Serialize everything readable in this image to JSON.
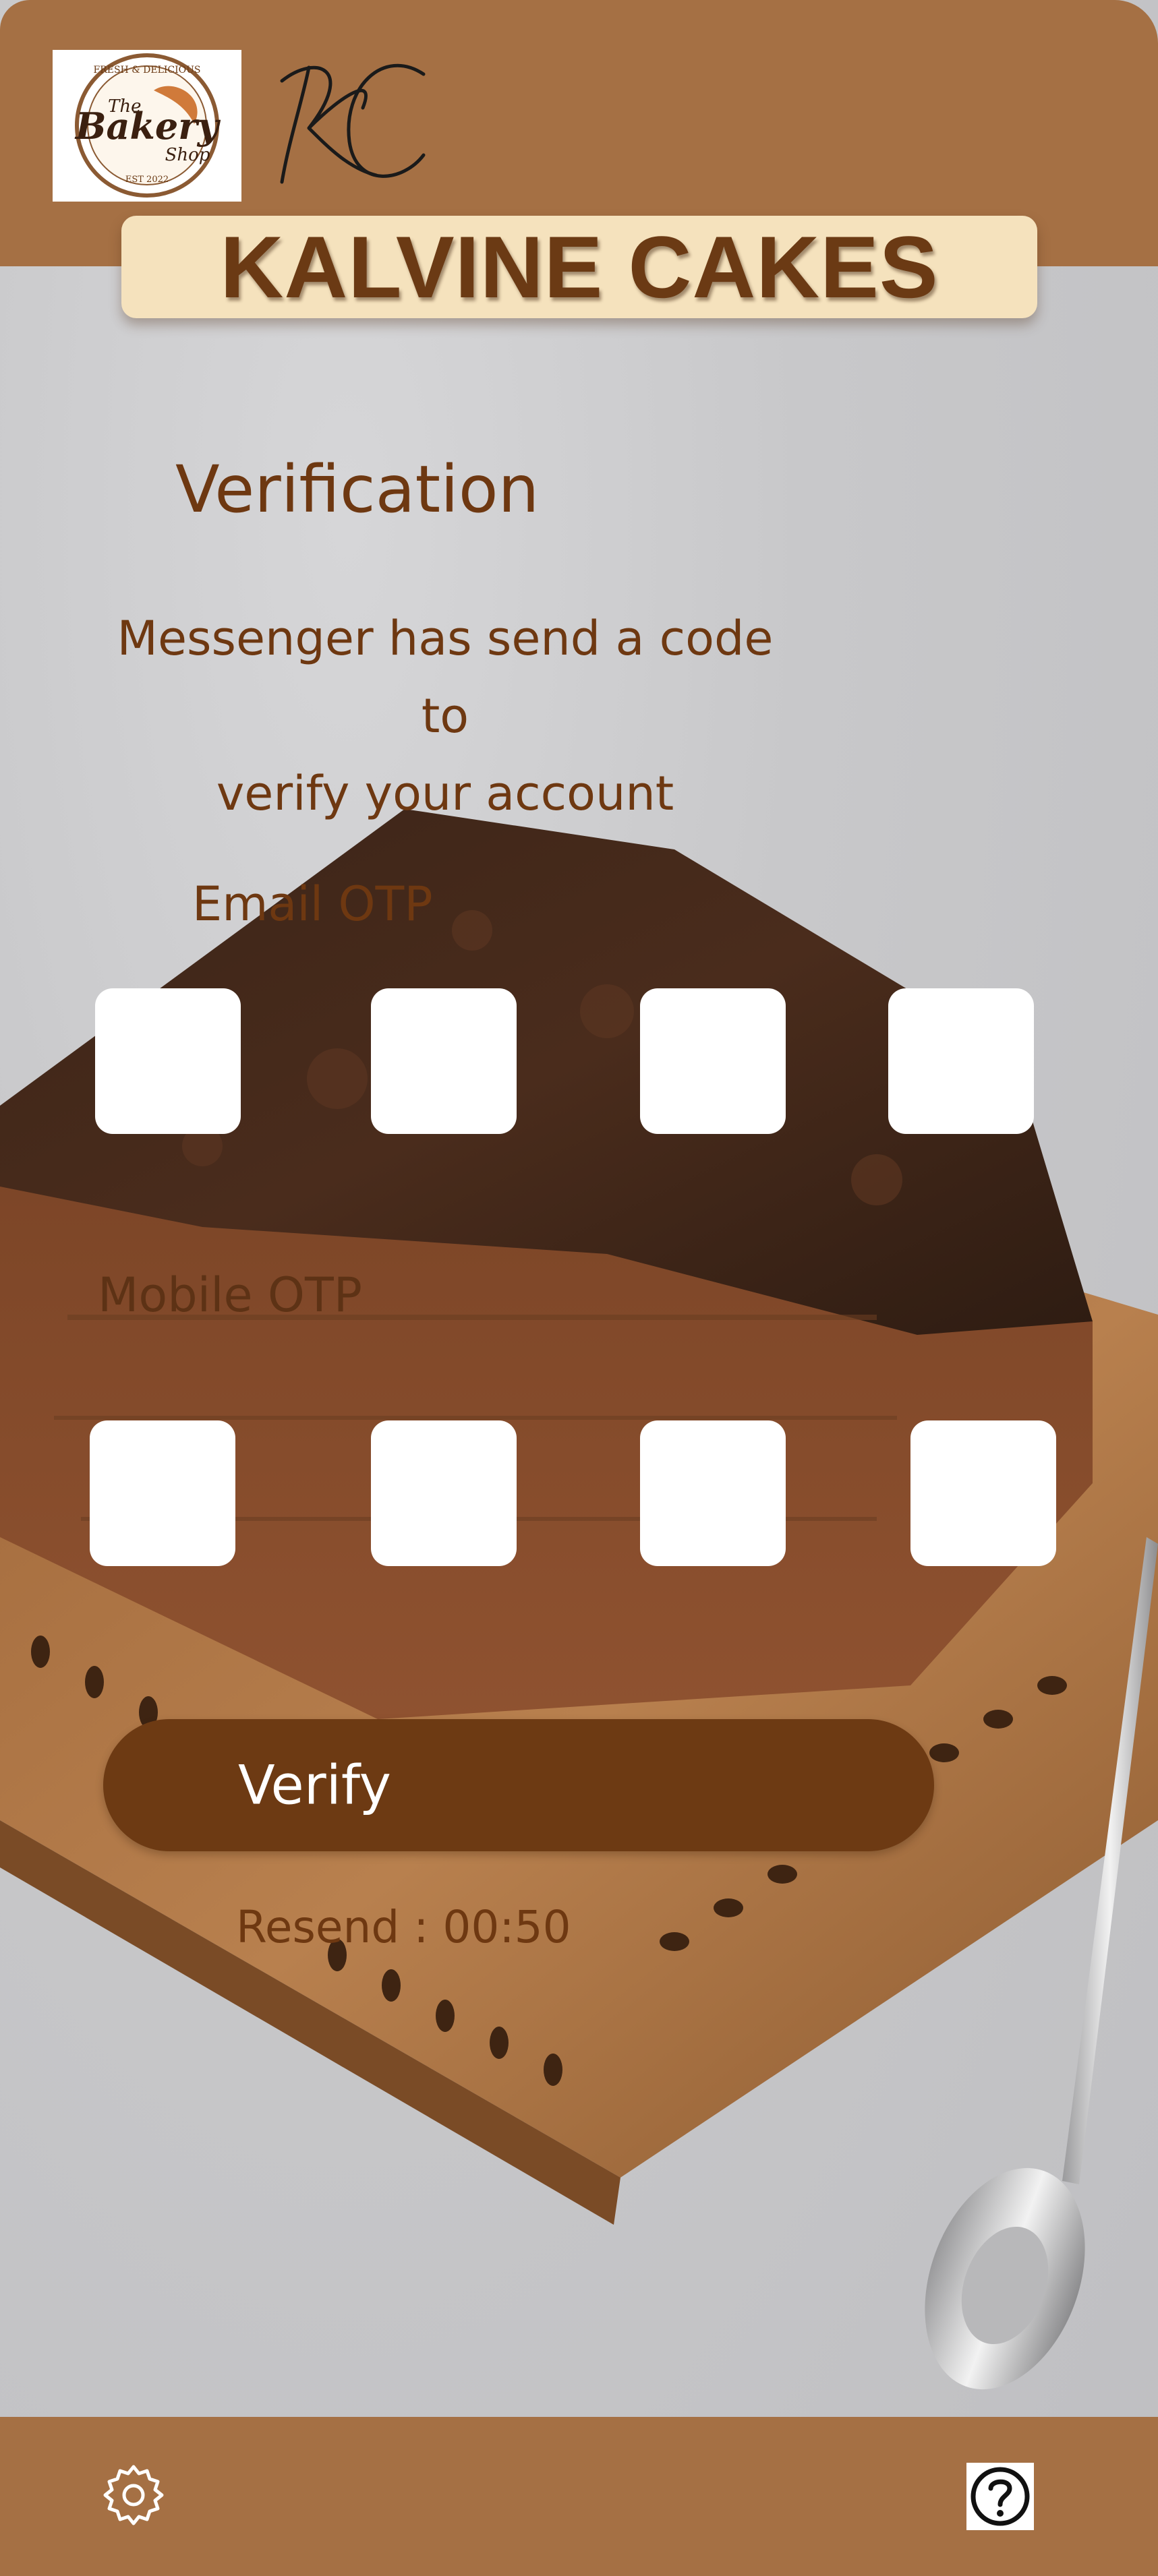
{
  "header": {
    "logo": {
      "alt": "The Bakery Shop",
      "line_top": "FRESH & DELICIOUS",
      "line_the": "The",
      "line_bakery": "Bakery",
      "line_shop": "Shop",
      "line_est": "EST 2022"
    },
    "monogram_icon": "kc-monogram-icon",
    "brand_name": "KALVINE CAKES"
  },
  "verification": {
    "title": "Verification",
    "subtitle_line1": "Messenger has send a code to",
    "subtitle_line2": "verify your account",
    "email_otp_label": "Email OTP",
    "mobile_otp_label": "Mobile OTP",
    "email_otp_values": [
      "",
      "",
      "",
      ""
    ],
    "mobile_otp_values": [
      "",
      "",
      "",
      ""
    ],
    "verify_label": "Verify",
    "resend_text": "Resend : 00:50"
  },
  "footer": {
    "settings_icon": "gear-icon",
    "help_icon": "question-mark-icon"
  },
  "colors": {
    "header_bg": "#a57044",
    "banner_bg": "#f5e2bd",
    "primary_text": "#6e3811",
    "button_bg": "#6d3a13"
  }
}
